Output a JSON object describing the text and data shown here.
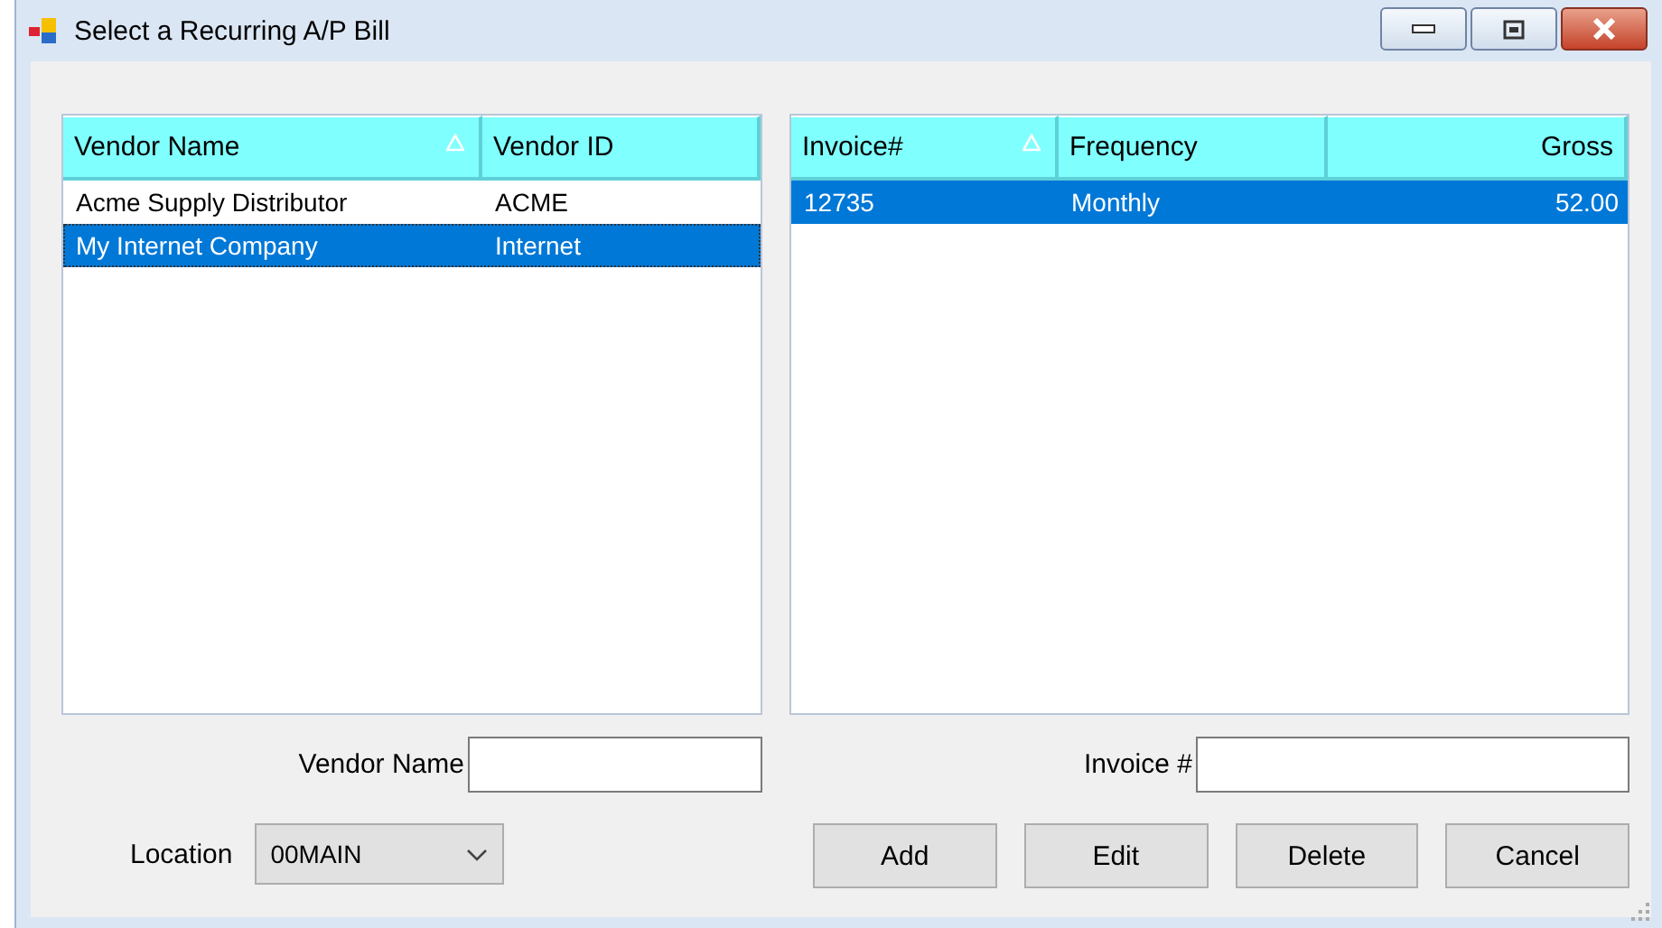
{
  "window": {
    "title": "Select a Recurring A/P Bill"
  },
  "vendors": {
    "columns": [
      {
        "label": "Vendor Name",
        "sorted": true,
        "kind": "text"
      },
      {
        "label": "Vendor ID",
        "sorted": false,
        "kind": "text"
      }
    ],
    "rows": [
      {
        "cells": [
          "Acme Supply Distributor",
          "ACME"
        ],
        "selected": false
      },
      {
        "cells": [
          "My Internet Company",
          "Internet"
        ],
        "selected": true
      }
    ]
  },
  "invoices": {
    "columns": [
      {
        "label": "Invoice#",
        "sorted": true,
        "kind": "text"
      },
      {
        "label": "Frequency",
        "sorted": false,
        "kind": "text"
      },
      {
        "label": "Gross",
        "sorted": false,
        "kind": "number"
      }
    ],
    "rows": [
      {
        "cells": [
          "12735",
          "Monthly",
          "52.00"
        ],
        "selected": true
      }
    ]
  },
  "vendor_name_filter": {
    "label": "Vendor Name"
  },
  "invoice_filter": {
    "label": "Invoice #"
  },
  "location": {
    "label": "Location",
    "value": "00MAIN"
  },
  "buttons": [
    "Add",
    "Edit",
    "Delete",
    "Cancel"
  ]
}
